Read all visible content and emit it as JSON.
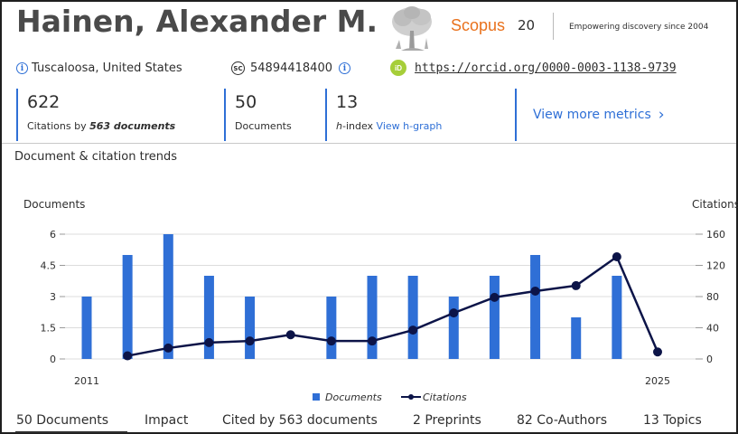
{
  "header": {
    "author_name": "Hainen, Alexander M.",
    "brand": "Scopus",
    "brand_count": "20",
    "tagline": "Empowering discovery since 2004"
  },
  "info": {
    "location": "Tuscaloosa, United States",
    "author_id": "54894418400",
    "orcid_url": "https://orcid.org/0000-0003-1138-9739",
    "orcid_badge": "iD",
    "sc_badge": "SC",
    "info_glyph": "i"
  },
  "metrics": {
    "citations_value": "622",
    "citations_label_prefix": "Citations by ",
    "citations_label_strong": "563 documents",
    "documents_value": "50",
    "documents_label": "Documents",
    "hindex_value": "13",
    "hindex_label_prefix": "h",
    "hindex_label_suffix": "-index ",
    "hindex_link": "View h-graph",
    "view_more": "View more metrics",
    "view_more_chevron": "›"
  },
  "trends_title": "Document & citation trends",
  "tabs": [
    "50 Documents",
    "Impact",
    "Cited by 563 documents",
    "2 Preprints",
    "82 Co-Authors",
    "13 Topics"
  ],
  "icons": [
    "info-icon",
    "scopus-id-icon",
    "orcid-icon",
    "chevron-right-icon",
    "tree-logo-icon"
  ],
  "colors": {
    "accent": "#2e6fd6",
    "bar": "#2f6fd6",
    "line": "#0c1448",
    "brand": "#e9711c",
    "orcid": "#a6ce39"
  },
  "chart_data": {
    "type": "bar+line",
    "x": [
      2011,
      2012,
      2013,
      2014,
      2015,
      2016,
      2017,
      2018,
      2019,
      2020,
      2021,
      2022,
      2023,
      2024,
      2025
    ],
    "x_tick_labels": [
      "2011",
      "2025"
    ],
    "series": [
      {
        "name": "Documents",
        "type": "bar",
        "axis": "left",
        "values": [
          3,
          5,
          6,
          4,
          3,
          0,
          3,
          4,
          4,
          3,
          4,
          5,
          2,
          4,
          0
        ]
      },
      {
        "name": "Citations",
        "type": "line",
        "axis": "right",
        "values": [
          null,
          4,
          14,
          21,
          23,
          31,
          23,
          23,
          37,
          59,
          79,
          87,
          94,
          131,
          9
        ]
      }
    ],
    "ylabel_left": "Documents",
    "ylabel_right": "Citations",
    "ylim_left": [
      0,
      6
    ],
    "ylim_right": [
      0,
      160
    ],
    "yticks_left": [
      "0",
      "1.5",
      "3",
      "4.5",
      "6"
    ],
    "yticks_right": [
      "0",
      "40",
      "80",
      "120",
      "160"
    ],
    "legend_position": "bottom-center",
    "grid": true
  }
}
